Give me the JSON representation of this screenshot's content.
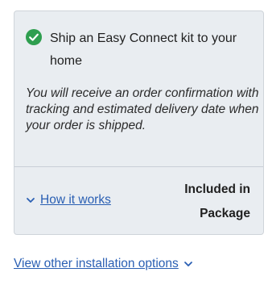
{
  "card": {
    "title": "Ship an Easy Connect kit to your home",
    "description": "You will receive an order confirmation with tracking and estimated delivery date when your order is shipped.",
    "how_it_works": "How it works",
    "included": "Included in Package",
    "check_color": "#2e9e4f",
    "link_color": "#2a5fb3"
  },
  "footer": {
    "link": "View other installation options"
  }
}
